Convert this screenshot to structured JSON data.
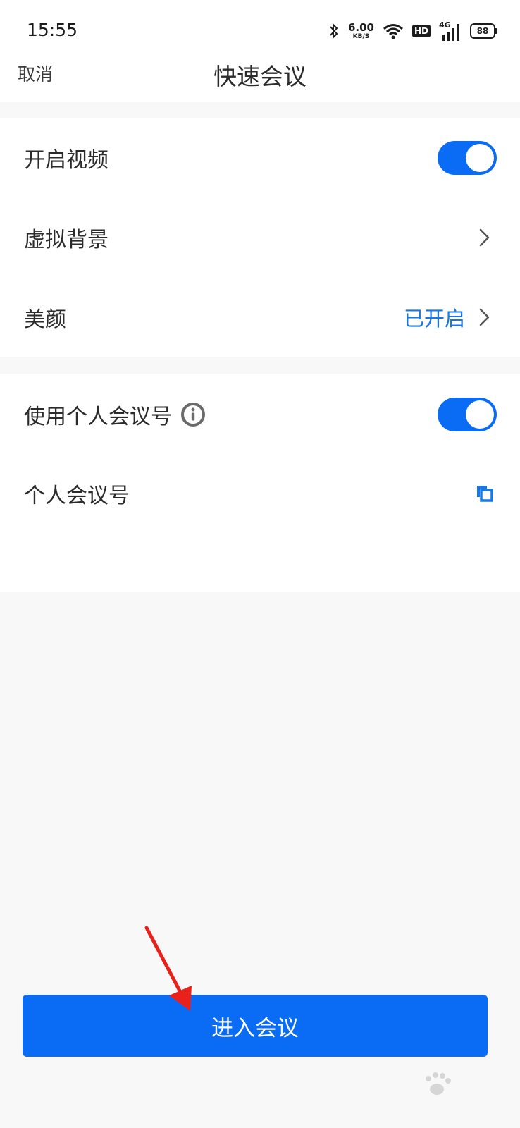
{
  "status_bar": {
    "time": "15:55",
    "net_speed_value": "6.00",
    "net_speed_unit": "KB/S",
    "hd_badge": "HD",
    "network_type": "4G",
    "battery": "88"
  },
  "nav": {
    "cancel_label": "取消",
    "title": "快速会议"
  },
  "settings_group_1": {
    "video_label": "开启视频",
    "video_enabled": true,
    "virtual_bg_label": "虚拟背景",
    "beauty_label": "美颜",
    "beauty_value": "已开启"
  },
  "settings_group_2": {
    "personal_id_toggle_label": "使用个人会议号",
    "personal_id_enabled": true,
    "personal_id_label": "个人会议号"
  },
  "actions": {
    "enter_meeting_label": "进入会议"
  },
  "colors": {
    "accent": "#0a6cf5",
    "value_text": "#1677e6",
    "annotation_arrow": "#e8211b",
    "background": "#f8f8f8"
  }
}
